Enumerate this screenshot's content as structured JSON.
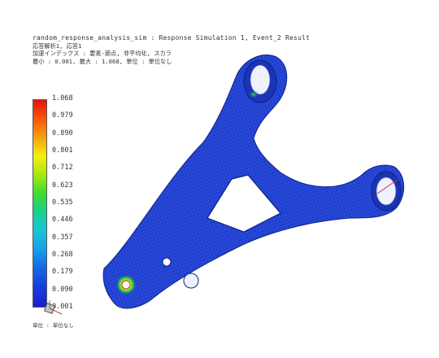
{
  "header": {
    "title": "random_response_analysis_sim : Response Simulation 1, Event_2 Result",
    "line2": "応答解析1, 応答1",
    "line3": "加速インデックス : 要素-節点, 非平均化, スカラ",
    "line4": "最小 : 0.001, 最大 : 1.068, 単位 : 単位なし"
  },
  "scale": {
    "labels": [
      "1.068",
      "0.979",
      "0.890",
      "0.801",
      "0.712",
      "0.623",
      "0.535",
      "0.446",
      "0.357",
      "0.268",
      "0.179",
      "0.090",
      "0.001"
    ]
  },
  "footer": {
    "units": "単位 : 単位なし"
  },
  "colors": {
    "mesh_blue": "#1f3fd0",
    "hot_red": "#e8120e"
  }
}
